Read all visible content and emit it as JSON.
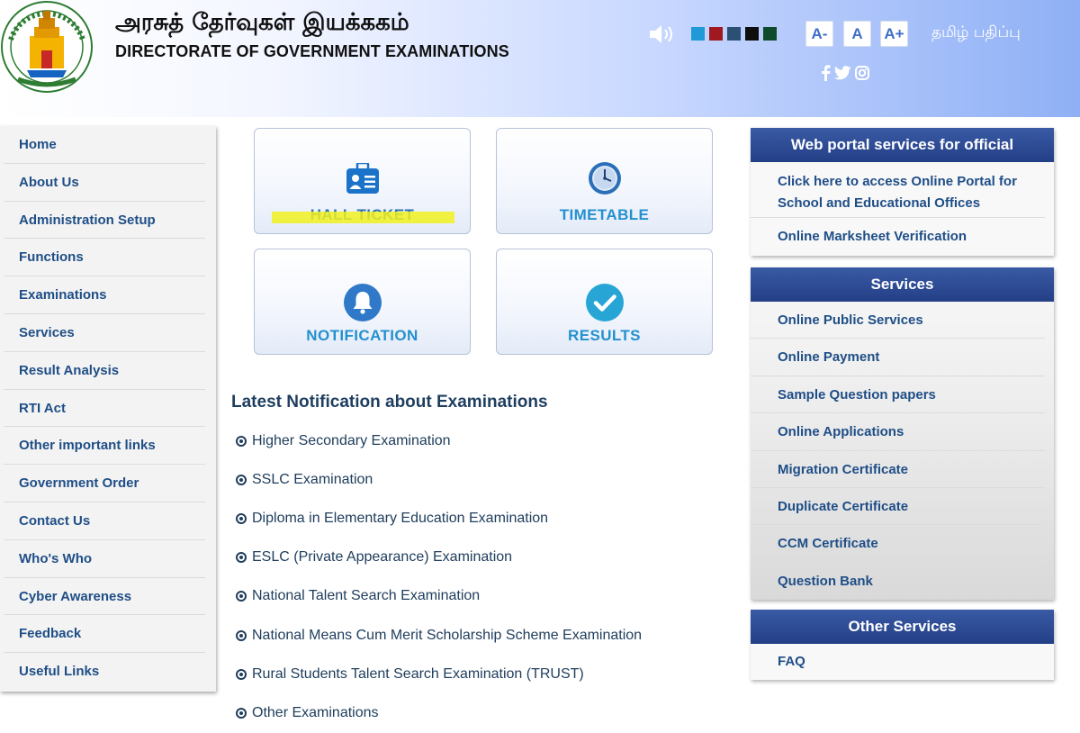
{
  "header": {
    "title_tamil": "அரசுத் தேர்வுகள் இயக்ககம்",
    "title_english": "DIRECTORATE OF GOVERNMENT EXAMINATIONS",
    "emblem_icon": "tamil-nadu-emblem-icon",
    "speaker_icon": "speaker-icon",
    "theme_colors": [
      "#1f9ad6",
      "#a01820",
      "#2c4f74",
      "#0e0e0e",
      "#0f4a2c"
    ],
    "font_decrease": "A-",
    "font_normal": "A",
    "font_increase": "A+",
    "tamil_version": "தமிழ் பதிப்பு",
    "social_icons": [
      "facebook-icon",
      "twitter-icon",
      "instagram-icon"
    ]
  },
  "sidebar": {
    "items": [
      {
        "label": "Home"
      },
      {
        "label": "About Us"
      },
      {
        "label": "Administration Setup"
      },
      {
        "label": "Functions"
      },
      {
        "label": "Examinations"
      },
      {
        "label": "Services"
      },
      {
        "label": "Result Analysis"
      },
      {
        "label": "RTI Act"
      },
      {
        "label": "Other important links"
      },
      {
        "label": "Government Order"
      },
      {
        "label": "Contact Us"
      },
      {
        "label": "Who's Who"
      },
      {
        "label": "Cyber Awareness"
      },
      {
        "label": "Feedback"
      },
      {
        "label": "Useful Links"
      }
    ]
  },
  "tiles": [
    {
      "label": "HALL TICKET",
      "icon": "id-card-icon"
    },
    {
      "label": "TIMETABLE",
      "icon": "clock-icon"
    },
    {
      "label": "NOTIFICATION",
      "icon": "bell-icon"
    },
    {
      "label": "RESULTS",
      "icon": "checkmark-icon"
    }
  ],
  "notifications": {
    "heading": "Latest Notification about Examinations",
    "items": [
      {
        "label": "Higher Secondary Examination"
      },
      {
        "label": "SSLC Examination"
      },
      {
        "label": "Diploma in Elementary Education Examination"
      },
      {
        "label": "ESLC (Private Appearance) Examination"
      },
      {
        "label": "National Talent Search Examination"
      },
      {
        "label": "National Means Cum Merit Scholarship Scheme Examination"
      },
      {
        "label": "Rural Students Talent Search Examination (TRUST)"
      },
      {
        "label": "Other Examinations"
      }
    ]
  },
  "panels": {
    "official": {
      "title": "Web portal services for official",
      "items": [
        {
          "label": "Click here to access Online Portal for School and Educational Offices"
        },
        {
          "label": "Online Marksheet Verification"
        }
      ]
    },
    "services": {
      "title": "Services",
      "items": [
        {
          "label": "Online Public Services"
        },
        {
          "label": "Online Payment"
        },
        {
          "label": "Sample Question papers"
        },
        {
          "label": "Online Applications"
        },
        {
          "label": "Migration Certificate"
        },
        {
          "label": "Duplicate Certificate"
        },
        {
          "label": "CCM Certificate"
        },
        {
          "label": "Question Bank"
        }
      ]
    },
    "other": {
      "title": "Other Services",
      "items": [
        {
          "label": "FAQ"
        }
      ]
    }
  },
  "colors": {
    "nav_text": "#1f4e87",
    "tile_text": "#2390cf",
    "panel_header": "#2a4a96",
    "highlight": "#f1f11f"
  }
}
